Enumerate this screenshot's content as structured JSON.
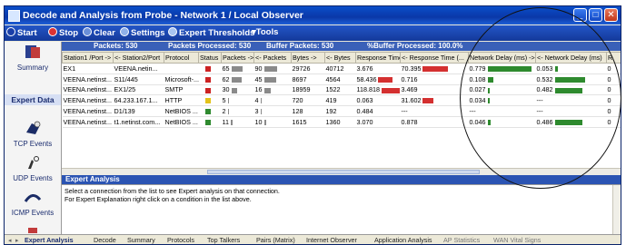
{
  "window": {
    "title": "Decode and Analysis from Probe - Network 1 / Local Observer",
    "minimize_label": "_",
    "maximize_label": "□",
    "close_label": "✕"
  },
  "toolbar": {
    "start": "Start",
    "stop": "Stop",
    "clear": "Clear",
    "settings": "Settings",
    "expert_thresholds": "Expert Thresholds",
    "tools": "Tools"
  },
  "sidebar": {
    "items": [
      {
        "label": "Summary",
        "icon": "summary-icon"
      },
      {
        "label": "Expert Data",
        "icon": ""
      },
      {
        "label": "TCP Events",
        "icon": "tcp-events-icon"
      },
      {
        "label": "UDP Events",
        "icon": "udp-events-icon"
      },
      {
        "label": "ICMP Events",
        "icon": "icmp-events-icon"
      }
    ]
  },
  "stats": {
    "packets": "Packets: 530",
    "processed": "Packets Processed: 530",
    "buffer_packets": "Buffer Packets: 530",
    "buffer_processed": "%Buffer Processed: 100.0%"
  },
  "table": {
    "columns": [
      "Station1 /Port ->",
      "<- Station2/Port",
      "Protocol",
      "Status",
      "Packets ->",
      "<- Packets",
      "Bytes ->",
      "<- Bytes",
      "Response Time (m...",
      "<- Response Time (...",
      "Network Delay (ms) ->",
      "<- Network Delay (ms)",
      "R"
    ],
    "rows": [
      {
        "s1": "EX1",
        "s2": "VEENA.netin...",
        "proto": "",
        "status": "red",
        "pk_out": "65",
        "pk_in": "90",
        "by_out": "29726",
        "by_in": "40712",
        "rt_out": "3.676",
        "rt_in": "70.395",
        "nd_out": "0.779",
        "nd_in": "0.053",
        "r": "0",
        "pk_bar": 0.6,
        "rt_out_bar": 0,
        "rt_in_bar": 0.7,
        "nd_out_bar": 0.95,
        "nd_in_bar": 0.05
      },
      {
        "s1": "VEENA.netinst...",
        "s2": "S11/445",
        "proto": "Microsoft-...",
        "status": "red",
        "pk_out": "62",
        "pk_in": "45",
        "by_out": "8697",
        "by_in": "4564",
        "rt_out": "58.436",
        "rt_in": "0.716",
        "nd_out": "0.108",
        "nd_in": "0.532",
        "r": "0",
        "pk_bar": 0.55,
        "rt_out_bar": 0.8,
        "rt_in_bar": 0,
        "nd_out_bar": 0.12,
        "nd_in_bar": 0.65
      },
      {
        "s1": "VEENA.netinst...",
        "s2": "EX1/25",
        "proto": "SMTP",
        "status": "red",
        "pk_out": "30",
        "pk_in": "16",
        "by_out": "18959",
        "by_in": "1522",
        "rt_out": "118.818",
        "rt_in": "3.469",
        "nd_out": "0.027",
        "nd_in": "0.482",
        "r": "0",
        "pk_bar": 0.3,
        "rt_out_bar": 1,
        "rt_in_bar": 0,
        "nd_out_bar": 0.03,
        "nd_in_bar": 0.6
      },
      {
        "s1": "VEENA.netinst...",
        "s2": "64.233.167.1...",
        "proto": "HTTP",
        "status": "yellow",
        "pk_out": "5",
        "pk_in": "4",
        "by_out": "720",
        "by_in": "419",
        "rt_out": "0.063",
        "rt_in": "31.602",
        "nd_out": "0.034",
        "nd_in": "---",
        "r": "0",
        "pk_bar": 0.05,
        "rt_out_bar": 0,
        "rt_in_bar": 0.3,
        "nd_out_bar": 0.04,
        "nd_in_bar": 0
      },
      {
        "s1": "VEENA.netinst...",
        "s2": "D1/139",
        "proto": "NetBIOS ...",
        "status": "green",
        "pk_out": "2",
        "pk_in": "3",
        "by_out": "128",
        "by_in": "192",
        "rt_out": "0.484",
        "rt_in": "---",
        "nd_out": "---",
        "nd_in": "---",
        "r": "0",
        "pk_bar": 0.02,
        "rt_out_bar": 0,
        "rt_in_bar": 0,
        "nd_out_bar": 0,
        "nd_in_bar": 0
      },
      {
        "s1": "VEENA.netinst...",
        "s2": "t1.netinst.com...",
        "proto": "NetBIOS ...",
        "status": "green",
        "pk_out": "11",
        "pk_in": "10",
        "by_out": "1615",
        "by_in": "1360",
        "rt_out": "3.070",
        "rt_in": "0.878",
        "nd_out": "0.046",
        "nd_in": "0.486",
        "r": "0",
        "pk_bar": 0.1,
        "rt_out_bar": 0,
        "rt_in_bar": 0,
        "nd_out_bar": 0.05,
        "nd_in_bar": 0.6
      }
    ]
  },
  "expert_analysis": {
    "heading": "Expert Analysis",
    "line1": "Select a connection from the list to see Expert analysis on that connection.",
    "line2": "For Expert Explanation right click on a condition in the list above."
  },
  "tabs": [
    "Expert Analysis",
    "Decode",
    "Summary",
    "Protocols",
    "Top Talkers",
    "Pairs (Matrix)",
    "Internet Observer",
    "Application Analysis",
    "AP Statistics",
    "WAN Vital Signs"
  ],
  "colors": {
    "red": "#cc2222",
    "yellow": "#e3c21a",
    "green": "#2f8a2f",
    "bar_green": "#2e8a2e",
    "bar_red": "#d43030",
    "bar_gray": "#8a8a8a"
  }
}
